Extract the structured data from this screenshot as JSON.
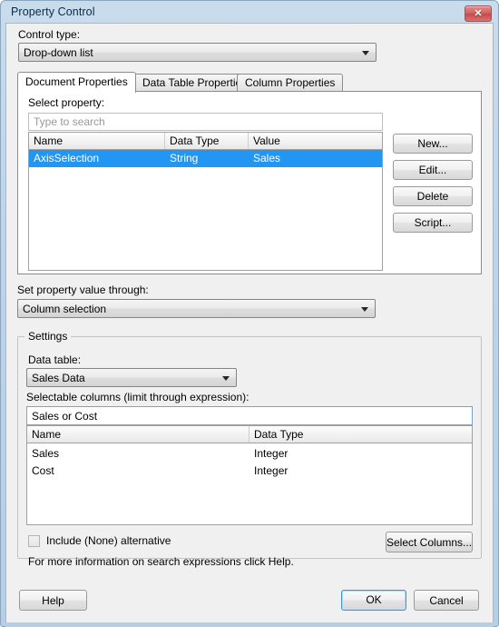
{
  "window": {
    "title": "Property Control",
    "close_label": "✕",
    "close_icon": "close-icon"
  },
  "control_type": {
    "label": "Control type:",
    "value": "Drop-down list"
  },
  "tabs": [
    {
      "label": "Document Properties",
      "active": true
    },
    {
      "label": "Data Table Properties",
      "active": false
    },
    {
      "label": "Column Properties",
      "active": false
    }
  ],
  "document_properties": {
    "select_label": "Select property:",
    "search_placeholder": "Type to search",
    "search_value": "",
    "columns": [
      "Name",
      "Data Type",
      "Value"
    ],
    "rows": [
      {
        "name": "AxisSelection",
        "data_type": "String",
        "value": "Sales",
        "selected": true
      }
    ],
    "buttons": [
      {
        "label": "New..."
      },
      {
        "label": "Edit..."
      },
      {
        "label": "Delete"
      },
      {
        "label": "Script..."
      }
    ]
  },
  "set_value_through": {
    "label": "Set property value through:",
    "value": "Column selection"
  },
  "settings": {
    "legend": "Settings",
    "data_table": {
      "label": "Data table:",
      "value": "Sales Data"
    },
    "selectable_columns": {
      "label": "Selectable columns (limit through expression):",
      "expression": "Sales or Cost",
      "columns": [
        "Name",
        "Data Type"
      ],
      "rows": [
        {
          "name": "Sales",
          "data_type": "Integer"
        },
        {
          "name": "Cost",
          "data_type": "Integer"
        }
      ]
    },
    "include_none": {
      "label": "Include (None) alternative",
      "checked": false
    },
    "help_note": "For more information on search expressions click Help.",
    "select_columns_button": "Select Columns..."
  },
  "footer": {
    "help": "Help",
    "ok": "OK",
    "cancel": "Cancel"
  },
  "colors": {
    "selection_blue": "#2196f3",
    "titlebar_blue": "#c9dcec",
    "focus_blue": "#3c96d4",
    "close_red": "#d45f5f"
  }
}
